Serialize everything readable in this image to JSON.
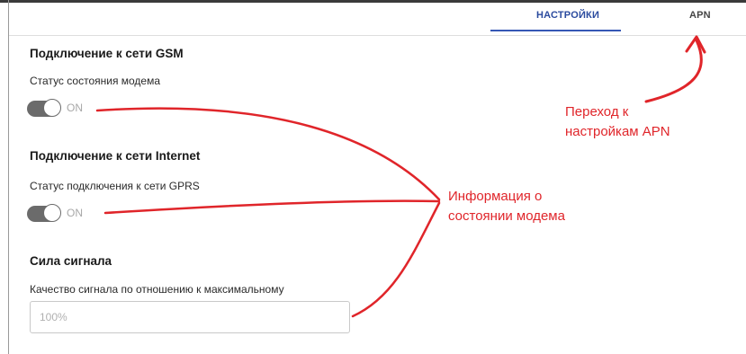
{
  "tabs": {
    "settings_label": "НАСТРОЙКИ",
    "apn_label": "APN"
  },
  "gsm": {
    "heading": "Подключение к сети GSM",
    "status_label": "Статус состояния модема",
    "toggle_text": "ON"
  },
  "internet": {
    "heading": "Подключение к сети Internet",
    "status_label": "Статус подключения к сети GPRS",
    "toggle_text": "ON"
  },
  "signal": {
    "heading": "Сила сигнала",
    "quality_label": "Качество сигнала по отношению к максимальному",
    "quality_value": "100%"
  },
  "annotations": {
    "apn_line1": "Переход к",
    "apn_line2": "настройкам APN",
    "info_line1": "Информация о",
    "info_line2": "состоянии модема"
  },
  "colors": {
    "accent": "#3557b5",
    "annotation": "#e0252a",
    "toggle": "#6b6b6b"
  }
}
